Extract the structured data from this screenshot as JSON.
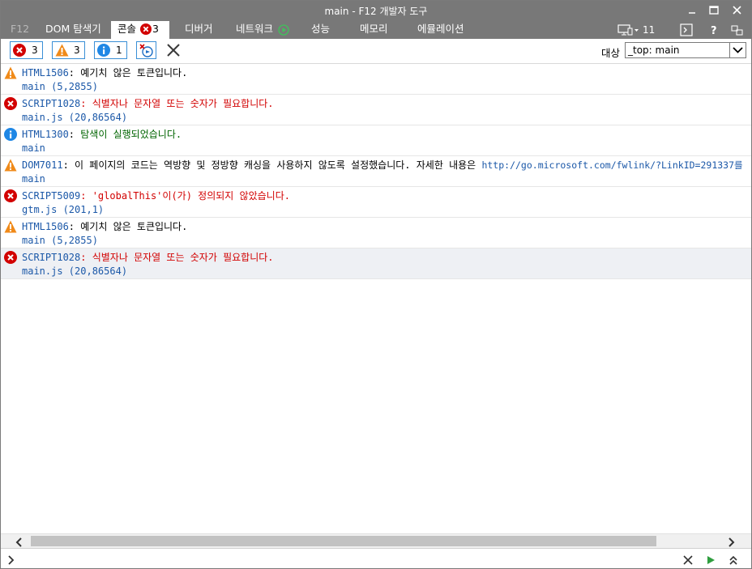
{
  "window": {
    "title": "main - F12 개발자 도구"
  },
  "tabs": [
    {
      "label": "F12"
    },
    {
      "label": "DOM 탐색기"
    },
    {
      "label": "콘솔",
      "badge": "3"
    },
    {
      "label": "디버거"
    },
    {
      "label": "네트워크"
    },
    {
      "label": "성능"
    },
    {
      "label": "메모리"
    },
    {
      "label": "에뮬레이션"
    }
  ],
  "tabbar_right": {
    "emulation_count": "11"
  },
  "toolbar": {
    "error_count": "3",
    "warning_count": "3",
    "info_count": "1",
    "target_label": "대상",
    "target_value": "_top: main"
  },
  "messages": [
    {
      "type": "warning",
      "code": "HTML1506",
      "text": "예기치 않은 토큰입니다.",
      "source": "main (5,2855)"
    },
    {
      "type": "error",
      "code": "SCRIPT1028",
      "text": "식별자나 문자열 또는 숫자가 필요합니다.",
      "source": "main.js (20,86564)"
    },
    {
      "type": "info",
      "code": "HTML1300",
      "text": "탐색이 실행되었습니다.",
      "source": "main"
    },
    {
      "type": "warning",
      "code": "DOM7011",
      "text": "이 페이지의 코드는 역방향 및 정방향 캐싱을 사용하지 않도록 설정했습니다. 자세한 내용은",
      "link": "http://go.microsoft.com/fwlink/?LinkID=291337를",
      "source": "main"
    },
    {
      "type": "error",
      "code": "SCRIPT5009",
      "text": "'globalThis'이(가) 정의되지 않았습니다.",
      "source": "gtm.js (201,1)"
    },
    {
      "type": "warning",
      "code": "HTML1506",
      "text": "예기치 않은 토큰입니다.",
      "source": "main (5,2855)"
    },
    {
      "type": "error",
      "code": "SCRIPT1028",
      "text": "식별자나 문자열 또는 숫자가 필요합니다.",
      "source": "main.js (20,86564)"
    }
  ],
  "colors": {
    "error": "#d20000",
    "info": "#006400",
    "code": "#1b58a8",
    "chrome": "#787878",
    "selection": "#eef0f4"
  }
}
